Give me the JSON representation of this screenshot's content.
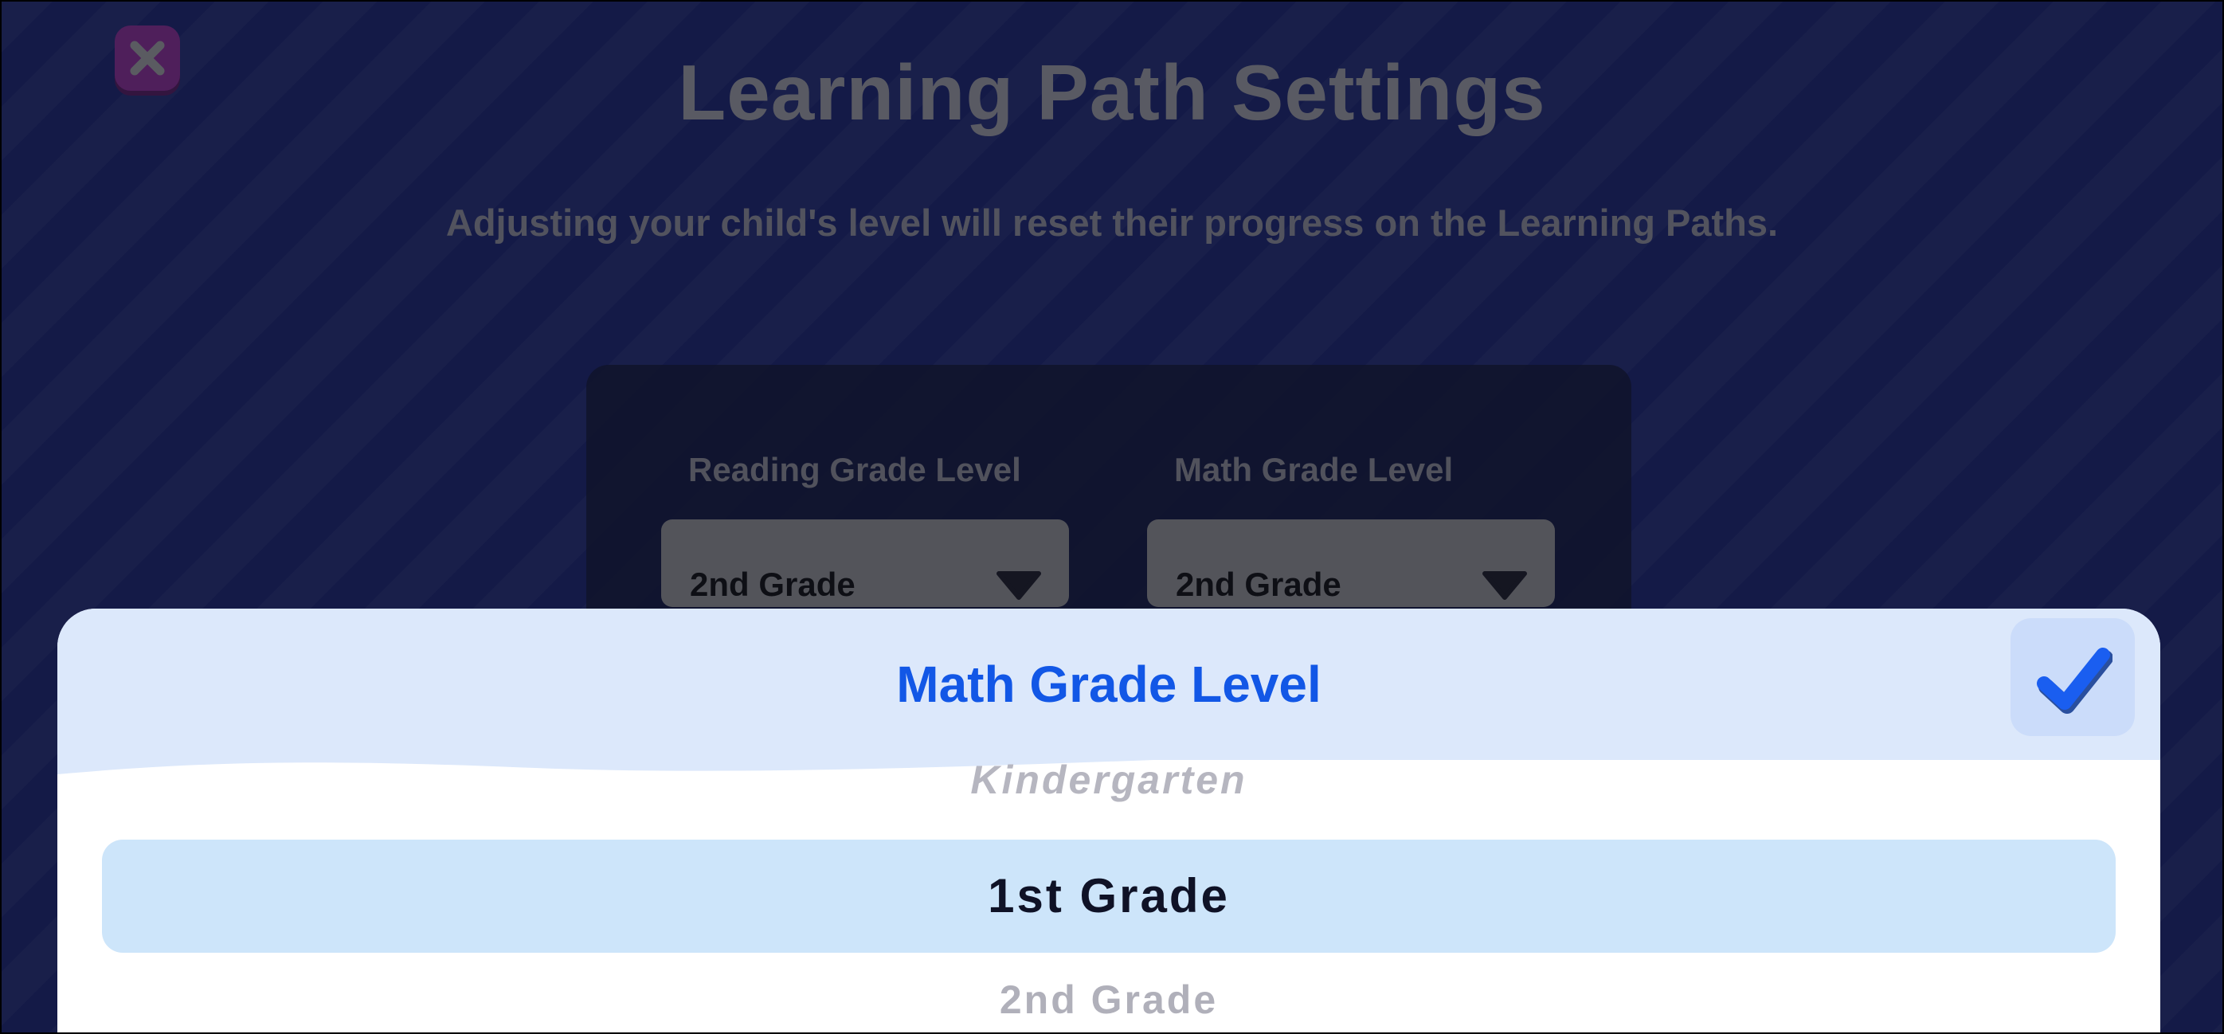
{
  "page": {
    "title": "Learning Path Settings",
    "subtitle": "Adjusting your child's level will reset their progress on the Learning Paths."
  },
  "close_button": {
    "icon": "close-icon"
  },
  "settings": {
    "reading": {
      "label": "Reading Grade Level",
      "value": "2nd Grade",
      "icon": "chevron-down-icon"
    },
    "math": {
      "label": "Math Grade Level",
      "value": "2nd Grade",
      "icon": "chevron-down-icon"
    }
  },
  "picker": {
    "title": "Math Grade Level",
    "confirm_icon": "checkmark-icon",
    "options": {
      "previous": "Kindergarten",
      "selected": "1st Grade",
      "next": "2nd Grade"
    }
  },
  "colors": {
    "background": "#1a2261",
    "close_button": "#7a2b82",
    "accent": "#1257e6",
    "sheet_header": "#dce8fb",
    "selected_row": "#cde5fa"
  }
}
